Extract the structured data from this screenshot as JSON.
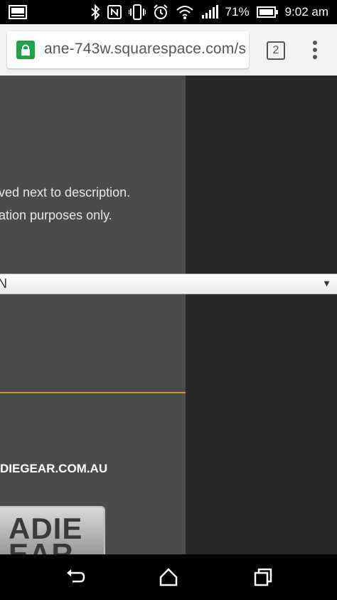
{
  "status_bar": {
    "battery": "71%",
    "time": "9:02 am"
  },
  "browser": {
    "url": "ane-743w.squarespace.com/s",
    "tab_count": "2"
  },
  "page": {
    "desc_line1": "ved next to description.",
    "desc_line2": "ation purposes only.",
    "select_value": "N",
    "select_arrow": "▼",
    "site_url": "DIEGEAR.COM.AU",
    "logo_line1": "ADIE",
    "logo_line2": "EAR"
  },
  "icons": {
    "gallery": "image-icon",
    "bluetooth": "bluetooth-icon",
    "nfc": "nfc-icon",
    "vibrate": "vibrate-icon",
    "alarm": "alarm-icon",
    "wifi": "wifi-icon",
    "signal": "signal-icon",
    "battery": "battery-icon",
    "lock": "lock-icon",
    "menu": "more-vert-icon",
    "back": "back-icon",
    "home": "home-icon",
    "recents": "recents-icon"
  },
  "colors": {
    "lock_green": "#1ea446",
    "accent_gold": "#c99a22",
    "panel_dark": "#272727",
    "panel_mid": "#4b4b4b"
  }
}
